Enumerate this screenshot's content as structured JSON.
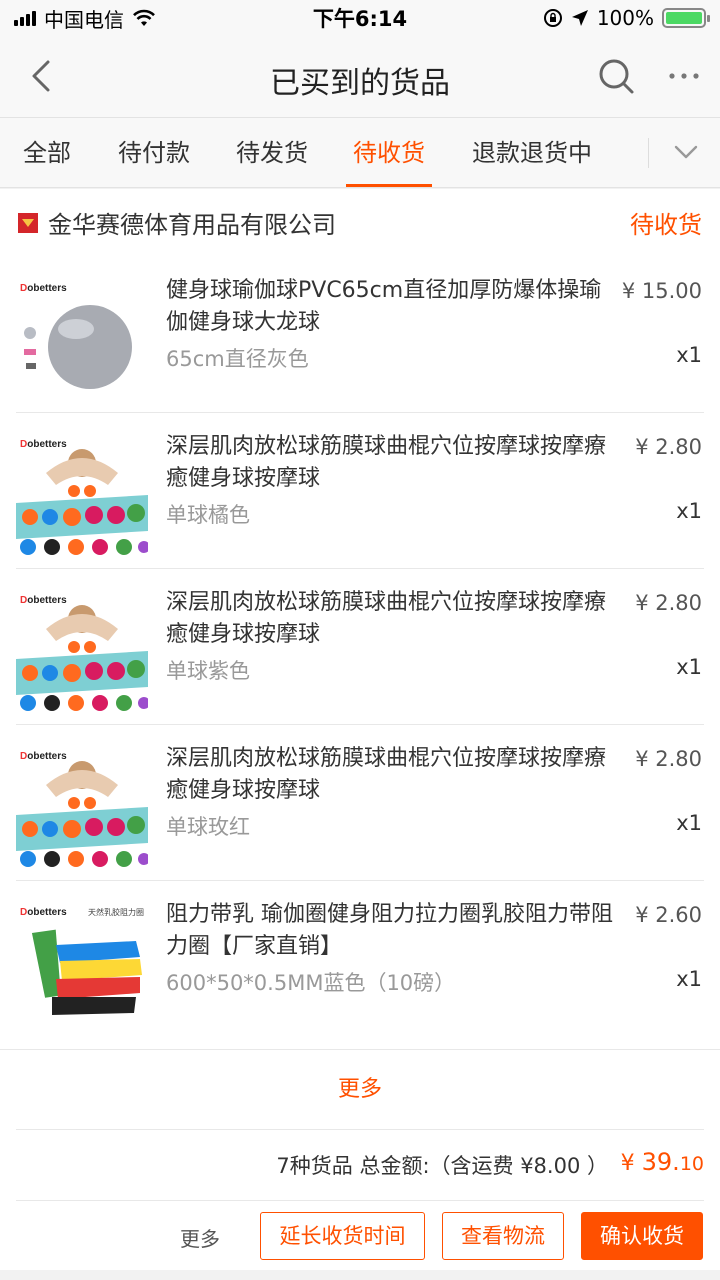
{
  "status_bar": {
    "carrier": "中国电信",
    "time": "下午6:14",
    "battery": "100%"
  },
  "header": {
    "title": "已买到的货品"
  },
  "tabs": [
    {
      "label": "全部"
    },
    {
      "label": "待付款"
    },
    {
      "label": "待发货"
    },
    {
      "label": "待收货",
      "active": true
    },
    {
      "label": "退款退货中"
    }
  ],
  "order": {
    "shop_name": "金华赛德体育用品有限公司",
    "status": "待收货",
    "items": [
      {
        "title": "健身球瑜伽球PVC65cm直径加厚防爆体操瑜伽健身球大龙球",
        "price": "¥ 15.00",
        "spec": "65cm直径灰色",
        "qty": "x1",
        "thumb_icon": "yoga-ball",
        "brand": "obetters"
      },
      {
        "title": "深层肌肉放松球筋膜球曲棍穴位按摩球按摩療癒健身球按摩球",
        "price": "¥ 2.80",
        "spec": "单球橘色",
        "qty": "x1",
        "thumb_icon": "massage-balls",
        "brand": "obetters"
      },
      {
        "title": "深层肌肉放松球筋膜球曲棍穴位按摩球按摩療癒健身球按摩球",
        "price": "¥ 2.80",
        "spec": "单球紫色",
        "qty": "x1",
        "thumb_icon": "massage-balls",
        "brand": "obetters"
      },
      {
        "title": "深层肌肉放松球筋膜球曲棍穴位按摩球按摩療癒健身球按摩球",
        "price": "¥ 2.80",
        "spec": "单球玫红",
        "qty": "x1",
        "thumb_icon": "massage-balls",
        "brand": "obetters"
      },
      {
        "title": "阻力带乳 瑜伽圈健身阻力拉力圈乳胶阻力带阻力圈【厂家直销】",
        "price": "¥ 2.60",
        "spec": "600*50*0.5MM蓝色（10磅）",
        "qty": "x1",
        "thumb_icon": "resistance-bands",
        "brand": "obetters",
        "thumb_caption": "天然乳胶阻力圈"
      }
    ],
    "more_label": "更多",
    "summary_text": "7种货品 总金额:（含运费 ¥8.00 ）",
    "total_symbol": "¥ ",
    "total_int": "39.",
    "total_dec": "10"
  },
  "actions": {
    "more": "更多",
    "extend": "延长收货时间",
    "logistics": "查看物流",
    "confirm": "确认收货"
  },
  "colors": {
    "accent": "#ff5000",
    "shop_logo": "#d4262a"
  }
}
